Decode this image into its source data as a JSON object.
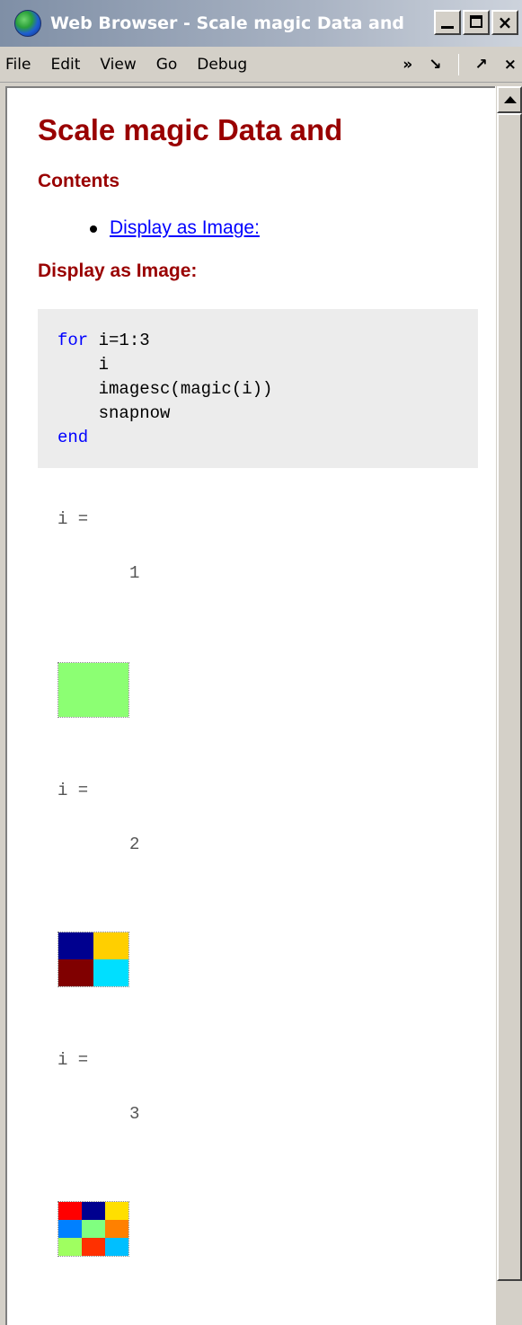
{
  "window": {
    "title": "Web Browser - Scale magic Data and",
    "buttons": {
      "minimize": "minimize",
      "maximize": "maximize",
      "close": "×"
    }
  },
  "menu": {
    "items": [
      "File",
      "Edit",
      "View",
      "Go",
      "Debug"
    ],
    "right": {
      "chevron": "»",
      "undock": "↘",
      "dock": "↗",
      "close": "×"
    }
  },
  "page": {
    "title": "Scale magic Data and",
    "contents_heading": "Contents",
    "toc": [
      "Display as Image:"
    ],
    "section_heading": "Display as Image:",
    "code": {
      "line1_kw": "for",
      "line1_rest": " i=1:3",
      "line2": "    i",
      "line3": "    imagesc(magic(i))",
      "line4": "    snapnow",
      "line5_kw": "end"
    },
    "outputs": [
      {
        "label": "i =",
        "value": "1"
      },
      {
        "label": "i =",
        "value": "2"
      },
      {
        "label": "i =",
        "value": "3"
      }
    ]
  },
  "images": {
    "img1": [
      "#8cff73"
    ],
    "img2": [
      "#00008f",
      "#ffcf00",
      "#800000",
      "#00dfff"
    ],
    "img3": [
      "#ff0000",
      "#00008f",
      "#ffdf00",
      "#0080ff",
      "#80ff80",
      "#ff8000",
      "#9fff60",
      "#ff3000",
      "#00bfff"
    ]
  },
  "icons": {
    "app": "globe-icon",
    "scroll_up": "triangle-up-icon"
  }
}
